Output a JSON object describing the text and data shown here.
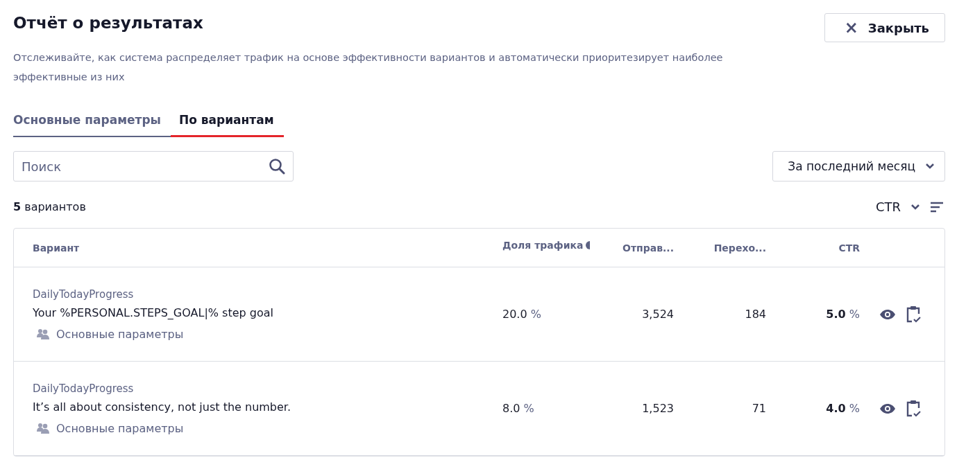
{
  "title": "Отчёт о результатах",
  "close_button": {
    "icon": "×",
    "label": "Закрыть"
  },
  "description": "Отслеживайте, как система распределяет трафик на основе эффективности вариантов и автоматически приоритезирует наиболее эффективные из них",
  "tabs": [
    {
      "label": "Основные параметры",
      "selected": false
    },
    {
      "label": "По вариантам",
      "selected": true
    }
  ],
  "search": {
    "placeholder": "Поиск"
  },
  "period": "За последний месяц",
  "count": "**5** вариантов",
  "sort": {
    "label": "CTR"
  },
  "table": {
    "columns": [
      "Вариант",
      "Доля трафика",
      "Отправ...",
      "Перехо...",
      "CTR"
    ],
    "rows": [
      {
        "group": "DailyTodayProgress",
        "text": "Your %PERSONAL.STEPS_GOAL|% step goal",
        "segment": "Основные параметры",
        "traffic": "20.0",
        "traffic_unit": "%",
        "sent": "3,524",
        "clicks": "184",
        "ctr": "5.0",
        "ctr_unit": "%"
      },
      {
        "group": "DailyTodayProgress",
        "text": "It’s all about consistency, not just the number.",
        "segment": "Основные параметры",
        "traffic": "8.0",
        "traffic_unit": "%",
        "sent": "1,523",
        "clicks": "71",
        "ctr": "4.0",
        "ctr_unit": "%"
      }
    ]
  }
}
